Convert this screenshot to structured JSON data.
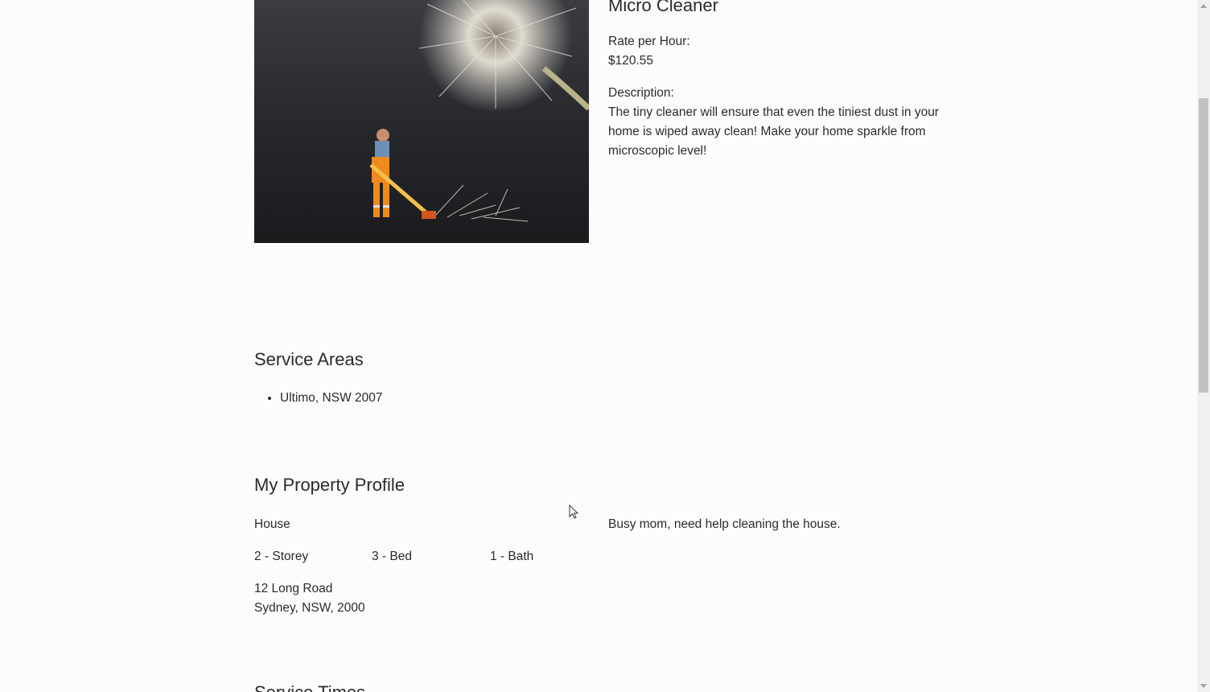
{
  "service": {
    "title": "Micro Cleaner",
    "rate_label": "Rate per Hour:",
    "rate_value": "$120.55",
    "description_label": "Description:",
    "description_text": "The tiny cleaner will ensure that even the tiniest dust in your home is wiped away clean! Make your home sparkle from microscopic level!"
  },
  "service_areas": {
    "heading": "Service Areas",
    "items": [
      "Ultimo, NSW 2007"
    ]
  },
  "property_profile": {
    "heading": "My Property Profile",
    "type": "House",
    "storey": "2 - Storey",
    "bed": "3 - Bed",
    "bath": "1 - Bath",
    "address_line1": "12 Long Road",
    "address_line2": "Sydney, NSW, 2000",
    "note": "Busy mom, need help cleaning the house."
  },
  "service_times": {
    "heading": "Service Times"
  },
  "colors": {
    "background": "#fcfcfc",
    "text": "#2b2b2b",
    "scrollbar_thumb": "#c1c1c1"
  }
}
